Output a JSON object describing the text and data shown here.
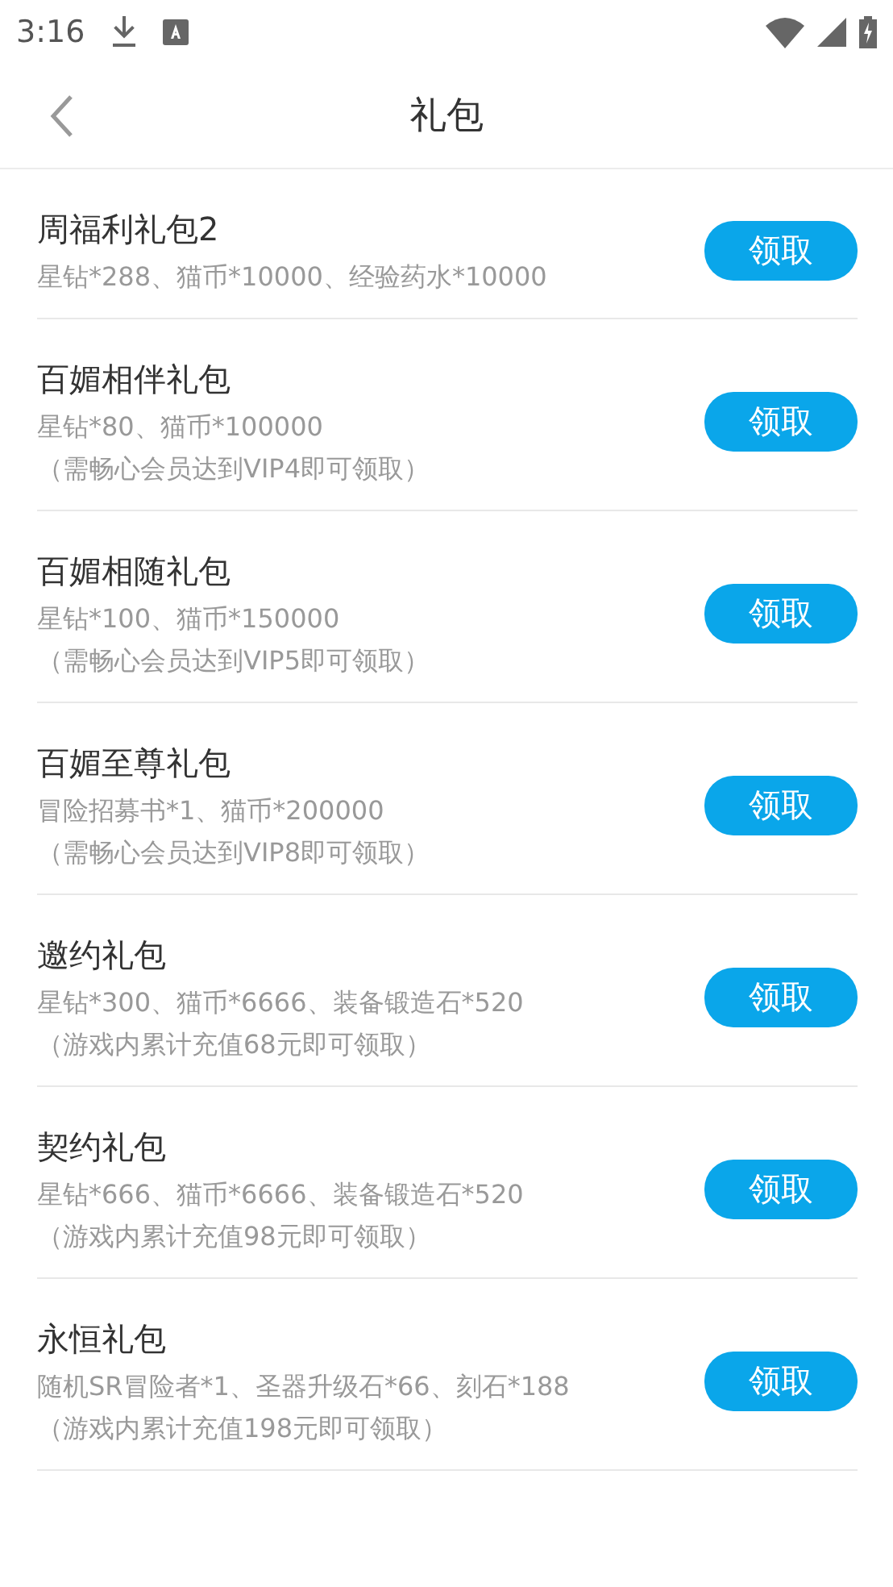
{
  "status_bar": {
    "time": "3:16"
  },
  "header": {
    "title": "礼包"
  },
  "gifts": [
    {
      "name": "周福利礼包2",
      "rewards": "星钻*288、猫币*10000、经验药水*10000",
      "button": "领取"
    },
    {
      "name": "百媚相伴礼包",
      "rewards": "星钻*80、猫币*100000",
      "condition": "（需畅心会员达到VIP4即可领取）",
      "button": "领取"
    },
    {
      "name": "百媚相随礼包",
      "rewards": "星钻*100、猫币*150000",
      "condition": "（需畅心会员达到VIP5即可领取）",
      "button": "领取"
    },
    {
      "name": "百媚至尊礼包",
      "rewards": "冒险招募书*1、猫币*200000",
      "condition": "（需畅心会员达到VIP8即可领取）",
      "button": "领取"
    },
    {
      "name": "邀约礼包",
      "rewards": "星钻*300、猫币*6666、装备锻造石*520",
      "condition": "（游戏内累计充值68元即可领取）",
      "button": "领取"
    },
    {
      "name": "契约礼包",
      "rewards": "星钻*666、猫币*6666、装备锻造石*520",
      "condition": "（游戏内累计充值98元即可领取）",
      "button": "领取"
    },
    {
      "name": "永恒礼包",
      "rewards": "随机SR冒险者*1、圣器升级石*66、刻石*188",
      "condition": "（游戏内累计充值198元即可领取）",
      "button": "领取"
    }
  ]
}
